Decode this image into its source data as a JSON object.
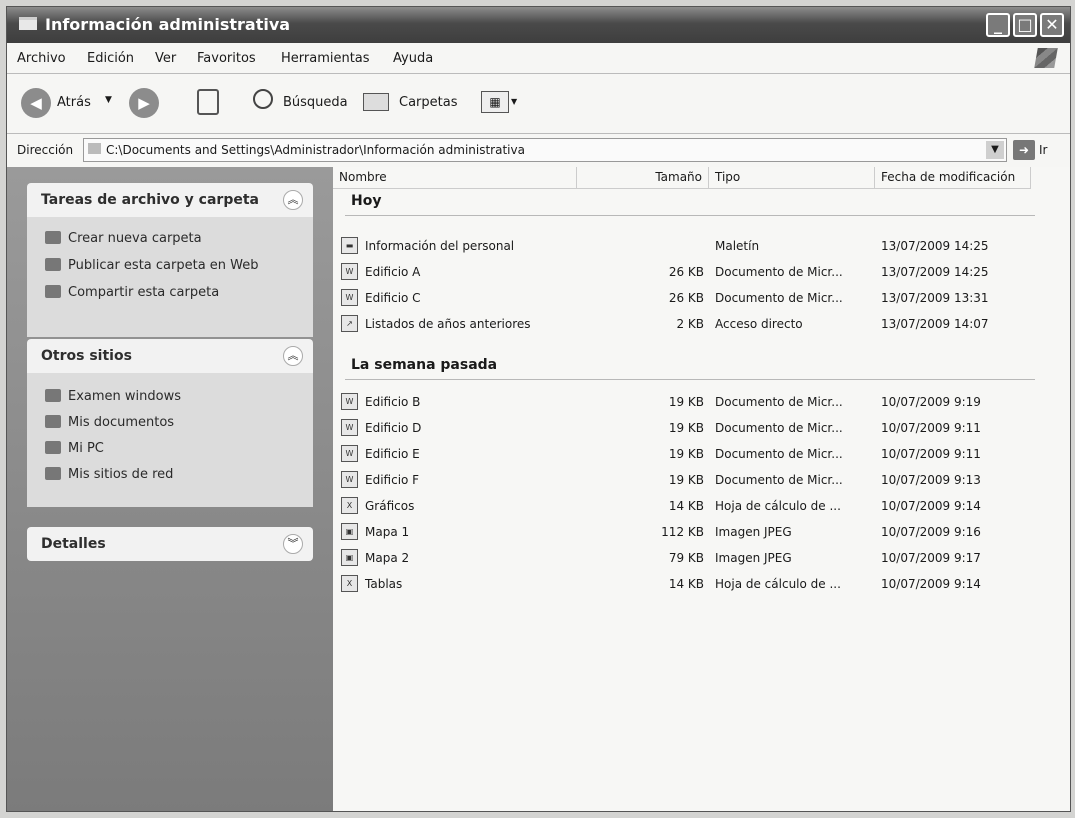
{
  "window": {
    "title": "Información administrativa",
    "icon": "folder-icon"
  },
  "menu": [
    "Archivo",
    "Edición",
    "Ver",
    "Favoritos",
    "Herramientas",
    "Ayuda"
  ],
  "toolbar": {
    "back": "Atrás",
    "search": "Búsqueda",
    "folders": "Carpetas"
  },
  "address": {
    "label": "Dirección",
    "path": "C:\\Documents and Settings\\Administrador\\Información administrativa",
    "go": "Ir"
  },
  "sidebar": {
    "tasks": {
      "title": "Tareas de archivo y carpeta",
      "items": [
        "Crear nueva carpeta",
        "Publicar esta carpeta en Web",
        "Compartir esta carpeta"
      ]
    },
    "places": {
      "title": "Otros sitios",
      "items": [
        "Examen windows",
        "Mis documentos",
        "Mi PC",
        "Mis sitios de red"
      ]
    },
    "details": {
      "title": "Detalles"
    }
  },
  "columns": {
    "name": "Nombre",
    "size": "Tamaño",
    "type": "Tipo",
    "date": "Fecha de modificación"
  },
  "groups": [
    {
      "label": "Hoy",
      "files": [
        {
          "name": "Información del personal",
          "size": "",
          "type": "Maletín",
          "date": "13/07/2009 14:25",
          "icon": "briefcase-icon"
        },
        {
          "name": "Edificio A",
          "size": "26 KB",
          "type": "Documento de Micr...",
          "date": "13/07/2009 14:25",
          "icon": "word-document-icon"
        },
        {
          "name": "Edificio C",
          "size": "26 KB",
          "type": "Documento de Micr...",
          "date": "13/07/2009 13:31",
          "icon": "word-document-icon"
        },
        {
          "name": "Listados de años anteriores",
          "size": "2 KB",
          "type": "Acceso directo",
          "date": "13/07/2009 14:07",
          "icon": "shortcut-icon"
        }
      ]
    },
    {
      "label": "La semana pasada",
      "files": [
        {
          "name": "Edificio B",
          "size": "19 KB",
          "type": "Documento de Micr...",
          "date": "10/07/2009 9:19",
          "icon": "word-document-icon"
        },
        {
          "name": "Edificio D",
          "size": "19 KB",
          "type": "Documento de Micr...",
          "date": "10/07/2009 9:11",
          "icon": "word-document-icon"
        },
        {
          "name": "Edificio E",
          "size": "19 KB",
          "type": "Documento de Micr...",
          "date": "10/07/2009 9:11",
          "icon": "word-document-icon"
        },
        {
          "name": "Edificio F",
          "size": "19 KB",
          "type": "Documento de Micr...",
          "date": "10/07/2009 9:13",
          "icon": "word-document-icon"
        },
        {
          "name": "Gráficos",
          "size": "14 KB",
          "type": "Hoja de cálculo de ...",
          "date": "10/07/2009 9:14",
          "icon": "spreadsheet-icon"
        },
        {
          "name": "Mapa 1",
          "size": "112 KB",
          "type": "Imagen JPEG",
          "date": "10/07/2009 9:16",
          "icon": "image-icon"
        },
        {
          "name": "Mapa 2",
          "size": "79 KB",
          "type": "Imagen JPEG",
          "date": "10/07/2009 9:17",
          "icon": "image-icon"
        },
        {
          "name": "Tablas",
          "size": "14 KB",
          "type": "Hoja de cálculo de ...",
          "date": "10/07/2009 9:14",
          "icon": "spreadsheet-icon"
        }
      ]
    }
  ]
}
